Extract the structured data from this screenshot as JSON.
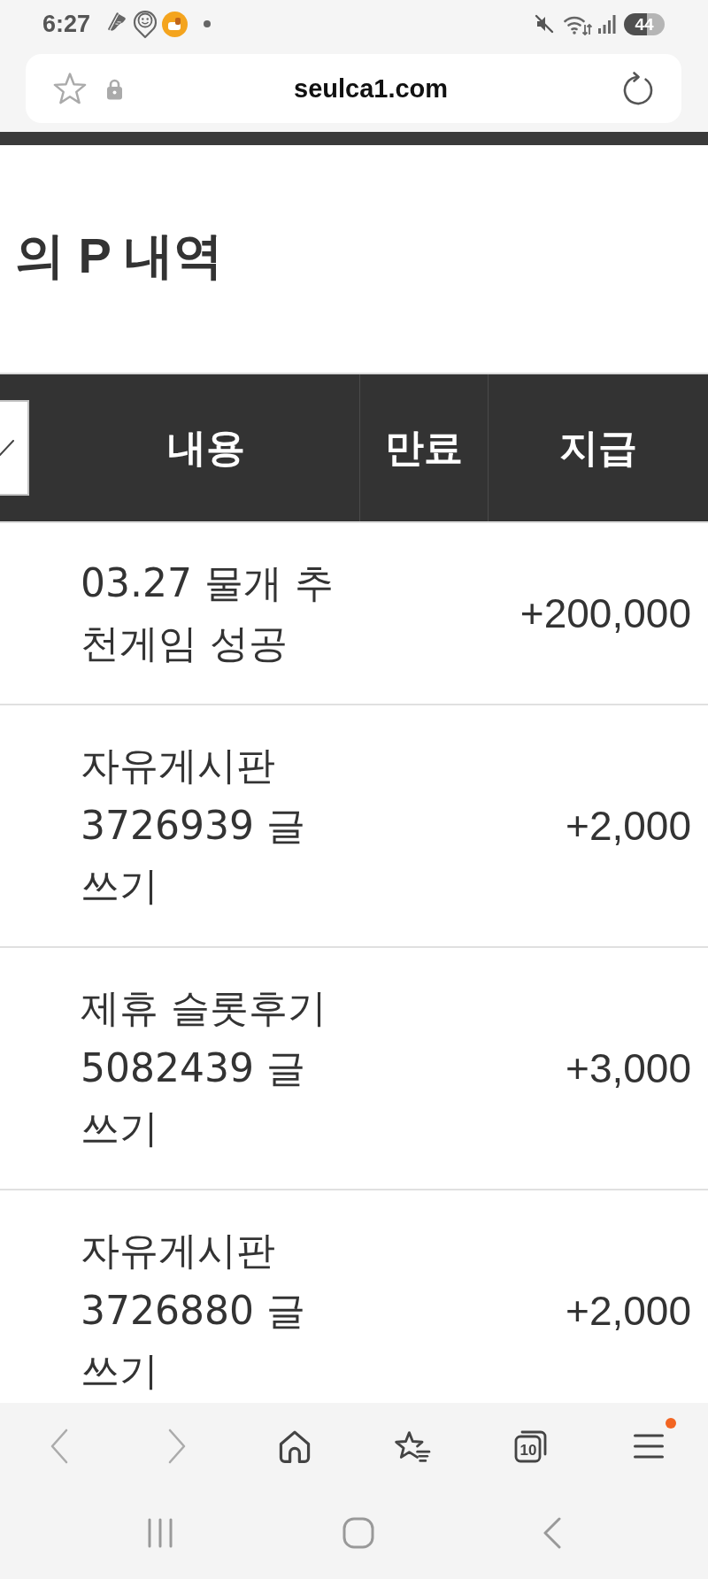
{
  "status_bar": {
    "time": "6:27",
    "battery": "44"
  },
  "browser": {
    "url": "seulca1.com"
  },
  "page": {
    "title": "의 P 내역"
  },
  "table": {
    "columns": [
      {
        "label": "내용"
      },
      {
        "label": "만료"
      },
      {
        "label": "지급"
      }
    ],
    "rows": [
      {
        "description": "03.27 물개 추천게임 성공",
        "amount": "+200,000"
      },
      {
        "description": "자유게시판 3726939 글쓰기",
        "amount": "+2,000"
      },
      {
        "description": "제휴 슬롯후기 5082439 글쓰기",
        "amount": "+3,000"
      },
      {
        "description": "자유게시판 3726880 글쓰기",
        "amount": "+2,000"
      }
    ]
  },
  "toolbar": [
    {
      "kind": "back",
      "disabled": true,
      "notification": false
    },
    {
      "kind": "forward",
      "disabled": true,
      "notification": false
    },
    {
      "kind": "home",
      "disabled": false,
      "notification": false
    },
    {
      "kind": "bookmarks",
      "disabled": false,
      "notification": false
    },
    {
      "kind": "tabs",
      "count": "10",
      "disabled": false,
      "notification": false
    },
    {
      "kind": "menu",
      "disabled": false,
      "notification": true
    }
  ]
}
